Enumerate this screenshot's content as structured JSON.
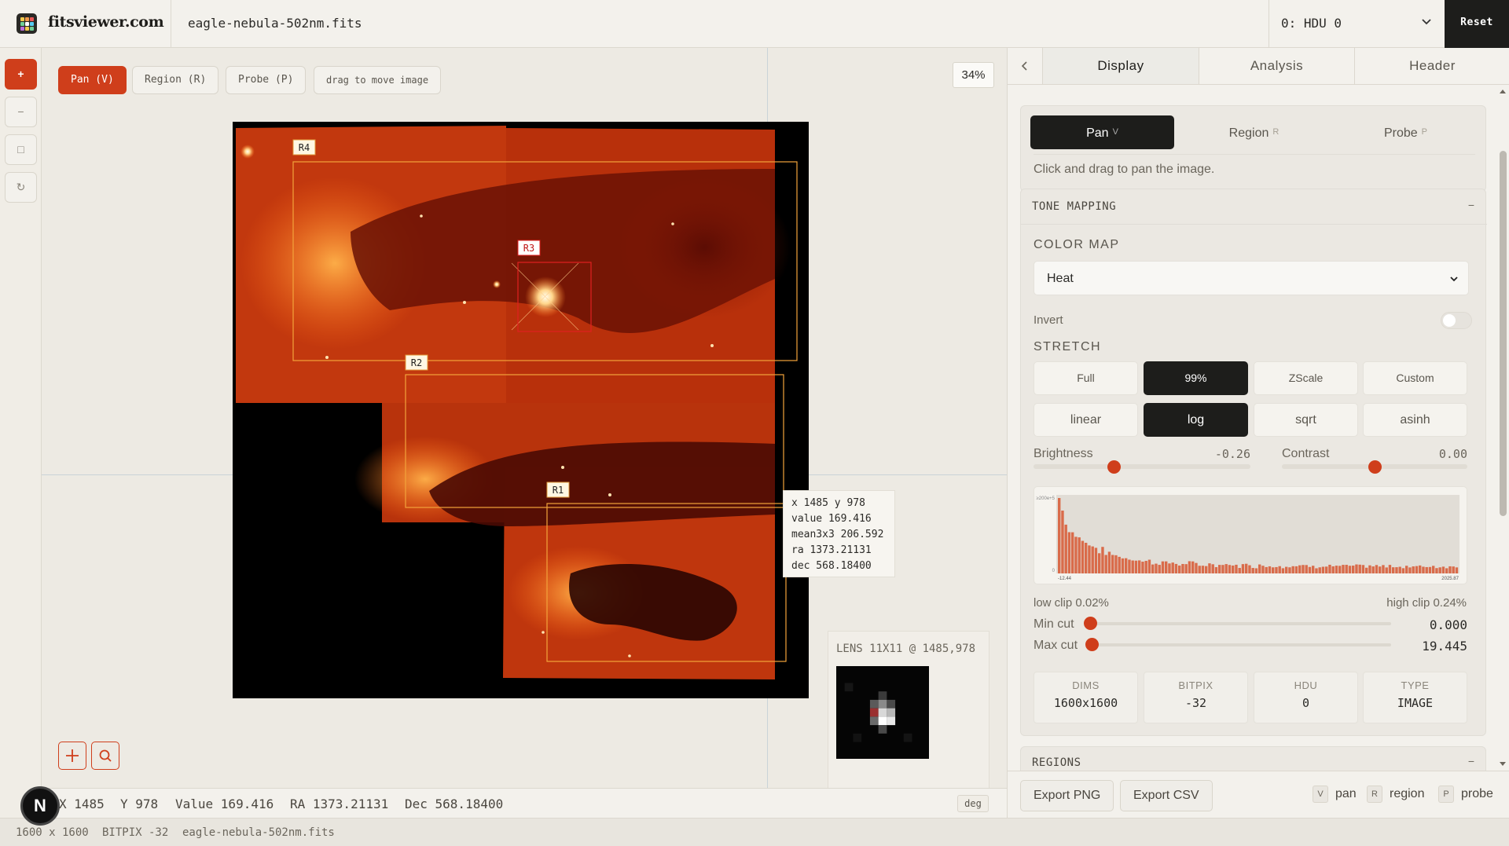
{
  "app": {
    "brand": "fitsviewer.com",
    "filename": "eagle-nebula-502nm.fits",
    "hdu_selected": "0: HDU 0",
    "reset_label": "Reset"
  },
  "rail": {
    "zoom_in": "+",
    "zoom_out": "−",
    "fit": "□",
    "rotate": "↻"
  },
  "toolbar": {
    "pan": "Pan (V)",
    "region": "Region (R)",
    "probe": "Probe (P)",
    "hint": "drag to move image",
    "zoom": "34%"
  },
  "regions": [
    "R4",
    "R3",
    "R2",
    "R1"
  ],
  "probe": {
    "line1": "x 1485 y 978",
    "line2": "value 169.416",
    "line3": "mean3x3 206.592",
    "line4": "ra 1373.21131",
    "line5": "dec 568.18400"
  },
  "lens": {
    "title": "LENS 11X11 @ 1485,978"
  },
  "coords": {
    "x": "X 1485",
    "y": "Y 978",
    "value": "Value 169.416",
    "ra": "RA 1373.21131",
    "dec": "Dec 568.18400",
    "unit": "deg"
  },
  "footer": {
    "dims": "1600 x 1600",
    "bitpix": "BITPIX -32",
    "file": "eagle-nebula-502nm.fits",
    "avatar": "N"
  },
  "panel": {
    "tabs": [
      "Display",
      "Analysis",
      "Header"
    ],
    "modes": [
      {
        "label": "Pan",
        "key": "V"
      },
      {
        "label": "Region",
        "key": "R"
      },
      {
        "label": "Probe",
        "key": "P"
      }
    ],
    "mode_hint": "Click and drag to pan the image.",
    "tone_title": "TONE MAPPING",
    "tone_collapse": "−",
    "colormap_label": "COLOR MAP",
    "colormap_value": "Heat",
    "invert_label": "Invert",
    "stretch_label": "STRETCH",
    "clip_options": [
      "Full",
      "99%",
      "ZScale",
      "Custom"
    ],
    "stretch_options": [
      "linear",
      "log",
      "sqrt",
      "asinh"
    ],
    "brightness_label": "Brightness",
    "brightness_value": "-0.26",
    "brightness": -0.26,
    "contrast_label": "Contrast",
    "contrast_value": "0.00",
    "contrast": 0.0,
    "histogram_min": "-12.44",
    "histogram_max": "2025.87",
    "histogram_ytick": "≥200e+5",
    "histogram_ytick0": "0",
    "low_clip": "low clip 0.02%",
    "high_clip": "high clip 0.24%",
    "min_cut_label": "Min cut",
    "min_cut_value": "0.000",
    "max_cut_label": "Max cut",
    "max_cut_value": "19.445",
    "stats": [
      {
        "k": "DIMS",
        "v": "1600x1600"
      },
      {
        "k": "BITPIX",
        "v": "-32"
      },
      {
        "k": "HDU",
        "v": "0"
      },
      {
        "k": "TYPE",
        "v": "IMAGE"
      }
    ],
    "regions_title": "REGIONS",
    "regions_collapse": "−",
    "export_png": "Export PNG",
    "export_csv": "Export CSV",
    "shortcuts": [
      {
        "key": "V",
        "label": "pan"
      },
      {
        "key": "R",
        "label": "region"
      },
      {
        "key": "P",
        "label": "probe"
      }
    ]
  },
  "colors": {
    "accent": "#cf3e1b",
    "dark": "#1d1d1b",
    "background": "#efece5"
  }
}
